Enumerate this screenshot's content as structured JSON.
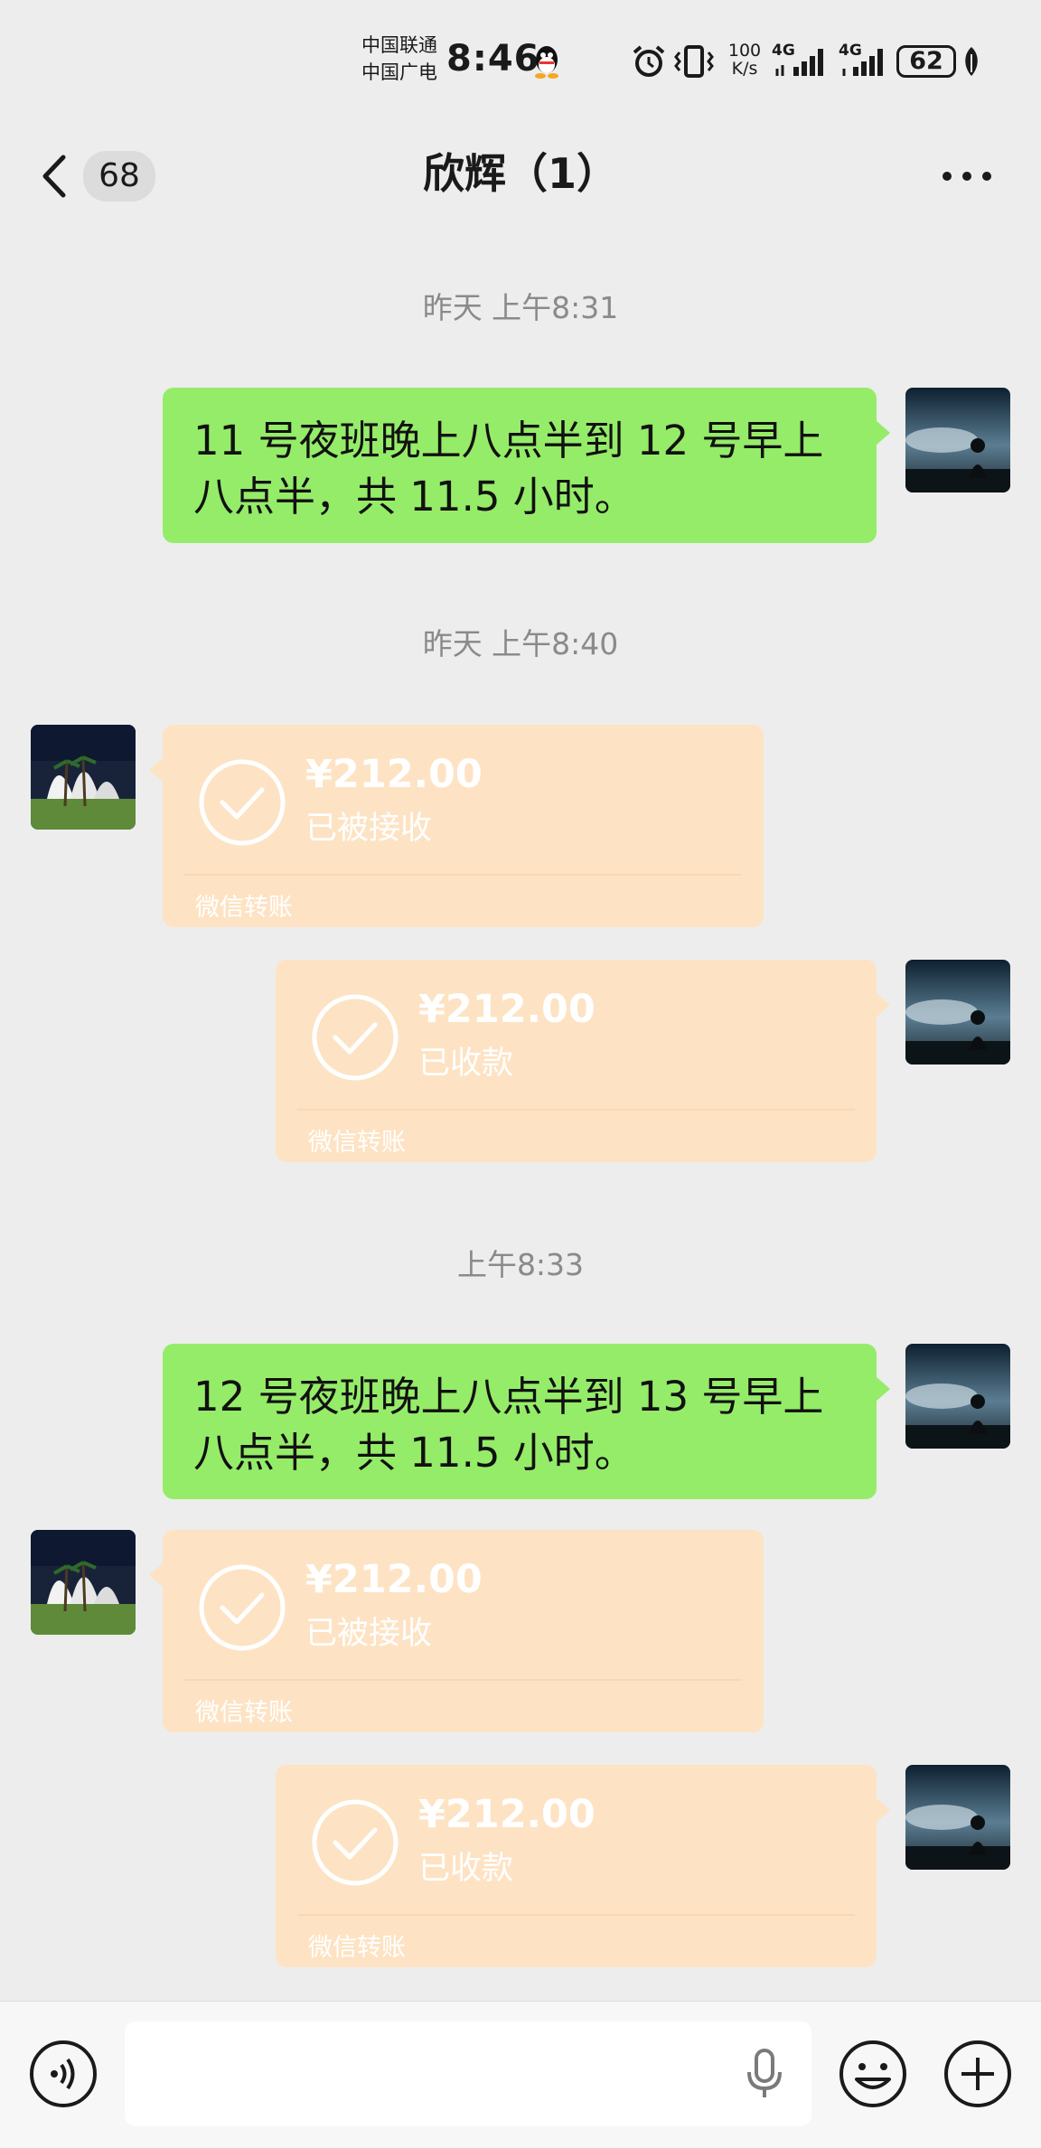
{
  "status_bar": {
    "carrier_line1": "中国联通",
    "carrier_line2": "中国广电",
    "time": "8:46",
    "net_speed_value": "100",
    "net_speed_unit": "K/s",
    "sim1_label": "4G",
    "sim2_label": "4G",
    "battery": "62"
  },
  "header": {
    "unread_count": "68",
    "title": "欣辉（1）"
  },
  "messages": {
    "ts1": "昨天 上午8:31",
    "msg1": "11 号夜班晚上八点半到 12 号早上八点半，共 11.5 小时。",
    "ts2": "昨天 上午8:40",
    "transfer1": {
      "amount": "¥212.00",
      "status": "已被接收",
      "label": "微信转账"
    },
    "transfer2": {
      "amount": "¥212.00",
      "status": "已收款",
      "label": "微信转账"
    },
    "ts3": "上午8:33",
    "msg2": "12 号夜班晚上八点半到 13 号早上八点半，共 11.5 小时。",
    "transfer3": {
      "amount": "¥212.00",
      "status": "已被接收",
      "label": "微信转账"
    },
    "transfer4": {
      "amount": "¥212.00",
      "status": "已收款",
      "label": "微信转账"
    }
  },
  "colors": {
    "background": "#ededed",
    "self_bubble": "#95ec69",
    "transfer_bubble": "#fde3c4"
  }
}
